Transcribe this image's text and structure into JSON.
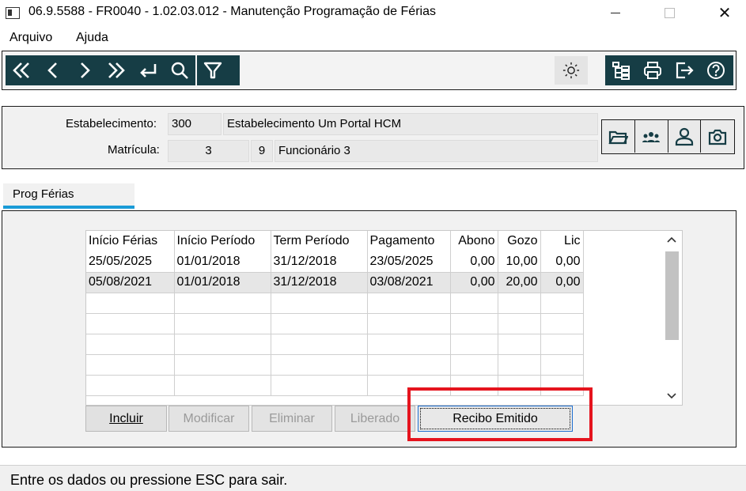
{
  "window": {
    "title": "06.9.5588 - FR0040 - 1.02.03.012 - Manutenção Programação de Férias",
    "close_glyph": "✕"
  },
  "menu": {
    "items": [
      "Arquivo",
      "Ajuda"
    ]
  },
  "toolbar": {
    "nav_icons": [
      "first-record-icon",
      "previous-icon",
      "next-icon",
      "last-record-icon",
      "goto-icon",
      "search-icon"
    ],
    "filter_icon": "filter-icon",
    "theme_icon": "sun-icon",
    "right_icons": [
      "tree-icon",
      "print-icon",
      "exit-icon",
      "help-icon"
    ]
  },
  "header": {
    "estabelecimento_label": "Estabelecimento:",
    "estabelecimento_code": "300",
    "estabelecimento_name": "Estabelecimento Um Portal HCM",
    "matricula_label": "Matrícula:",
    "matricula_value": "3",
    "matricula_digit": "9",
    "funcionario_name": "Funcionário 3"
  },
  "tab": {
    "label": "Prog Férias"
  },
  "grid": {
    "columns": [
      "Início Férias",
      "Início Período",
      "Term Período",
      "Pagamento",
      "Abono",
      "Gozo",
      "Lic"
    ],
    "rows": [
      [
        "25/05/2025",
        "01/01/2018",
        "31/12/2018",
        "23/05/2025",
        "0,00",
        "10,00",
        "0,00"
      ],
      [
        "05/08/2021",
        "01/01/2018",
        "31/12/2018",
        "03/08/2021",
        "0,00",
        "20,00",
        "0,00"
      ]
    ],
    "selected_row": 1
  },
  "buttons": {
    "incluir": "Incluir",
    "modificar": "Modificar",
    "eliminar": "Eliminar",
    "liberado": "Liberado",
    "recibo": "Recibo Emitido"
  },
  "status": {
    "text": "Entre os dados ou pressione ESC para sair."
  },
  "colors": {
    "toolbar": "#163d45",
    "tab_underline": "#1a9bd7",
    "highlight": "#e5141e"
  }
}
